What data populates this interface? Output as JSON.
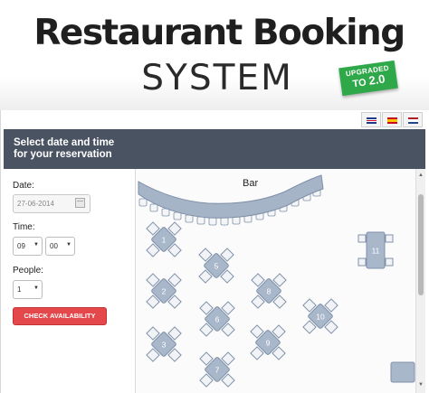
{
  "hero": {
    "title": "Restaurant Booking",
    "subtitle": "SYSTEM",
    "badge_line1": "UPGRADED",
    "badge_to": "TO",
    "badge_version": "2.0"
  },
  "languages": [
    {
      "name": "uk-flag-icon"
    },
    {
      "name": "spain-flag-icon"
    },
    {
      "name": "netherlands-flag-icon"
    }
  ],
  "panel": {
    "header_line1": "Select date and time",
    "header_line2": "for your reservation"
  },
  "form": {
    "date_label": "Date:",
    "date_value": "27-06-2014",
    "time_label": "Time:",
    "hour_value": "09",
    "minute_value": "00",
    "people_label": "People:",
    "people_value": "1",
    "check_button": "CHECK AVAILABILITY"
  },
  "floor_plan": {
    "bar_label": "Bar",
    "tables": [
      {
        "number": "1",
        "shape": "diamond"
      },
      {
        "number": "2",
        "shape": "diamond"
      },
      {
        "number": "3",
        "shape": "diamond"
      },
      {
        "number": "5",
        "shape": "diamond"
      },
      {
        "number": "6",
        "shape": "diamond"
      },
      {
        "number": "7",
        "shape": "diamond"
      },
      {
        "number": "8",
        "shape": "diamond"
      },
      {
        "number": "9",
        "shape": "diamond"
      },
      {
        "number": "10",
        "shape": "diamond"
      },
      {
        "number": "11",
        "shape": "rect"
      }
    ]
  },
  "colors": {
    "header_bg": "#4a5362",
    "button_red": "#e4484a",
    "badge_green": "#2fa84a",
    "table_fill": "#a9b7cb",
    "table_stroke": "#7f91a8"
  }
}
